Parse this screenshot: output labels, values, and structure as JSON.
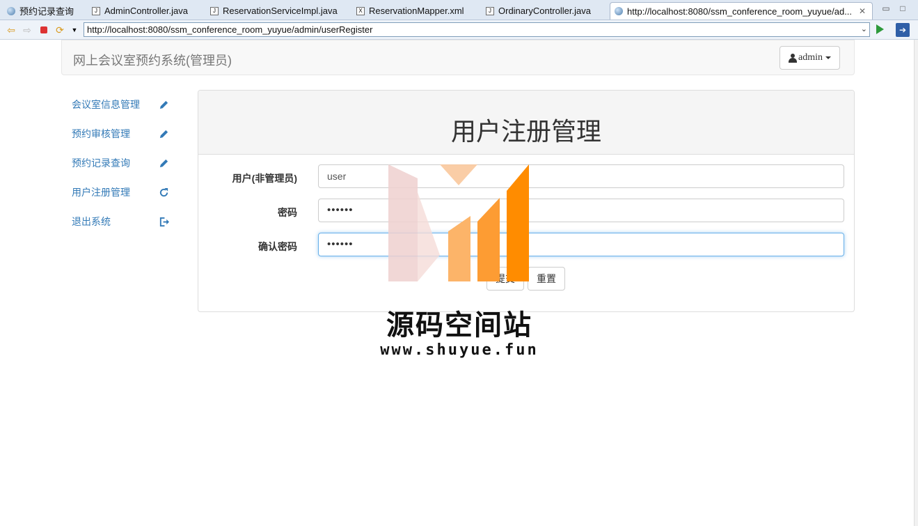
{
  "ide_tabs": [
    {
      "label": "预约记录查询",
      "icon": "globe-icon",
      "active": false
    },
    {
      "label": "AdminController.java",
      "icon": "java-file-icon",
      "active": false
    },
    {
      "label": "ReservationServiceImpl.java",
      "icon": "java-file-icon",
      "active": false
    },
    {
      "label": "ReservationMapper.xml",
      "icon": "xml-file-icon",
      "active": false
    },
    {
      "label": "OrdinaryController.java",
      "icon": "java-file-icon",
      "active": false
    },
    {
      "label": "http://localhost:8080/ssm_conference_room_yuyue/ad...",
      "icon": "globe-icon",
      "active": true
    }
  ],
  "browser": {
    "url": "http://localhost:8080/ssm_conference_room_yuyue/admin/userRegister"
  },
  "navbar": {
    "brand": "网上会议室预约系统(管理员)",
    "user_label": "admin"
  },
  "sidebar": {
    "items": [
      {
        "label": "会议室信息管理",
        "icon": "pencil-icon"
      },
      {
        "label": "预约审核管理",
        "icon": "pencil-icon"
      },
      {
        "label": "预约记录查询",
        "icon": "pencil-icon"
      },
      {
        "label": "用户注册管理",
        "icon": "refresh-icon"
      },
      {
        "label": "退出系统",
        "icon": "logout-icon"
      }
    ]
  },
  "panel": {
    "title": "用户注册管理"
  },
  "form": {
    "username_label": "用户(非管理员)",
    "username_value": "user",
    "password_label": "密码",
    "password_value": "••••••",
    "confirm_label": "确认密码",
    "confirm_value": "••••••",
    "submit_label": "提交",
    "reset_label": "重置"
  },
  "watermark": {
    "name": "源码空间站",
    "url": "www.shuyue.fun"
  },
  "colors": {
    "link": "#337ab7",
    "focus_border": "#66afe9",
    "watermark_orange": "#ff8c00"
  }
}
